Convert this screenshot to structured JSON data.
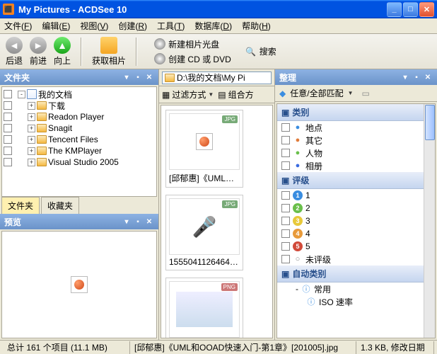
{
  "title": "My Pictures - ACDSee 10",
  "menus": [
    {
      "label": "文件",
      "key": "F"
    },
    {
      "label": "编辑",
      "key": "E"
    },
    {
      "label": "视图",
      "key": "V"
    },
    {
      "label": "创建",
      "key": "R"
    },
    {
      "label": "工具",
      "key": "T"
    },
    {
      "label": "数据库",
      "key": "D"
    },
    {
      "label": "帮助",
      "key": "H"
    }
  ],
  "toolbar": {
    "back": "后退",
    "forward": "前进",
    "up": "向上",
    "get": "获取相片",
    "newdisc": "新建相片光盘",
    "search": "搜索",
    "createcd": "创建 CD 或 DVD"
  },
  "folders": {
    "title": "文件夹",
    "root": "我的文档",
    "items": [
      "下载",
      "Readon Player",
      "Snagit",
      "Tencent Files",
      "The KMPlayer",
      "Visual Studio 2005"
    ],
    "tab_folders": "文件夹",
    "tab_fav": "收藏夹"
  },
  "preview": {
    "title": "预览"
  },
  "mid": {
    "path": "D:\\我的文档\\My Pi",
    "filter": "过滤方式",
    "group": "组合方",
    "thumbs": [
      {
        "cap": "[邱郁惠]《UML和O...",
        "badge": "JPG",
        "kind": "ppt"
      },
      {
        "cap": "15550411264649559...",
        "badge": "JPG",
        "kind": "mic"
      },
      {
        "cap": "",
        "badge": "PNG",
        "kind": "png"
      }
    ]
  },
  "organize": {
    "title": "整理",
    "match": "任意/全部匹配",
    "sections": {
      "category": {
        "title": "类别",
        "items": [
          {
            "label": "地点",
            "icon": "globe",
            "color": "#3a8de0"
          },
          {
            "label": "其它",
            "icon": "pin",
            "color": "#e07b3a"
          },
          {
            "label": "人物",
            "icon": "people",
            "color": "#6abf4b"
          },
          {
            "label": "相册",
            "icon": "book",
            "color": "#3a6be0"
          }
        ]
      },
      "rating": {
        "title": "评级",
        "items": [
          "1",
          "2",
          "3",
          "4",
          "5"
        ],
        "unrated": "未评级",
        "colors": [
          "#3a8de0",
          "#6abf4b",
          "#e8c93a",
          "#e89a3a",
          "#d14a3a"
        ]
      },
      "auto": {
        "title": "自动类别",
        "common": "常用",
        "iso": "ISO 速率"
      }
    }
  },
  "status": {
    "total": "总计 161 个项目 (11.1 MB)",
    "file": "[邱郁惠]《UML和OOAD快速入门-第1章》[201005].jpg",
    "size": "1.3 KB, 修改日期"
  }
}
